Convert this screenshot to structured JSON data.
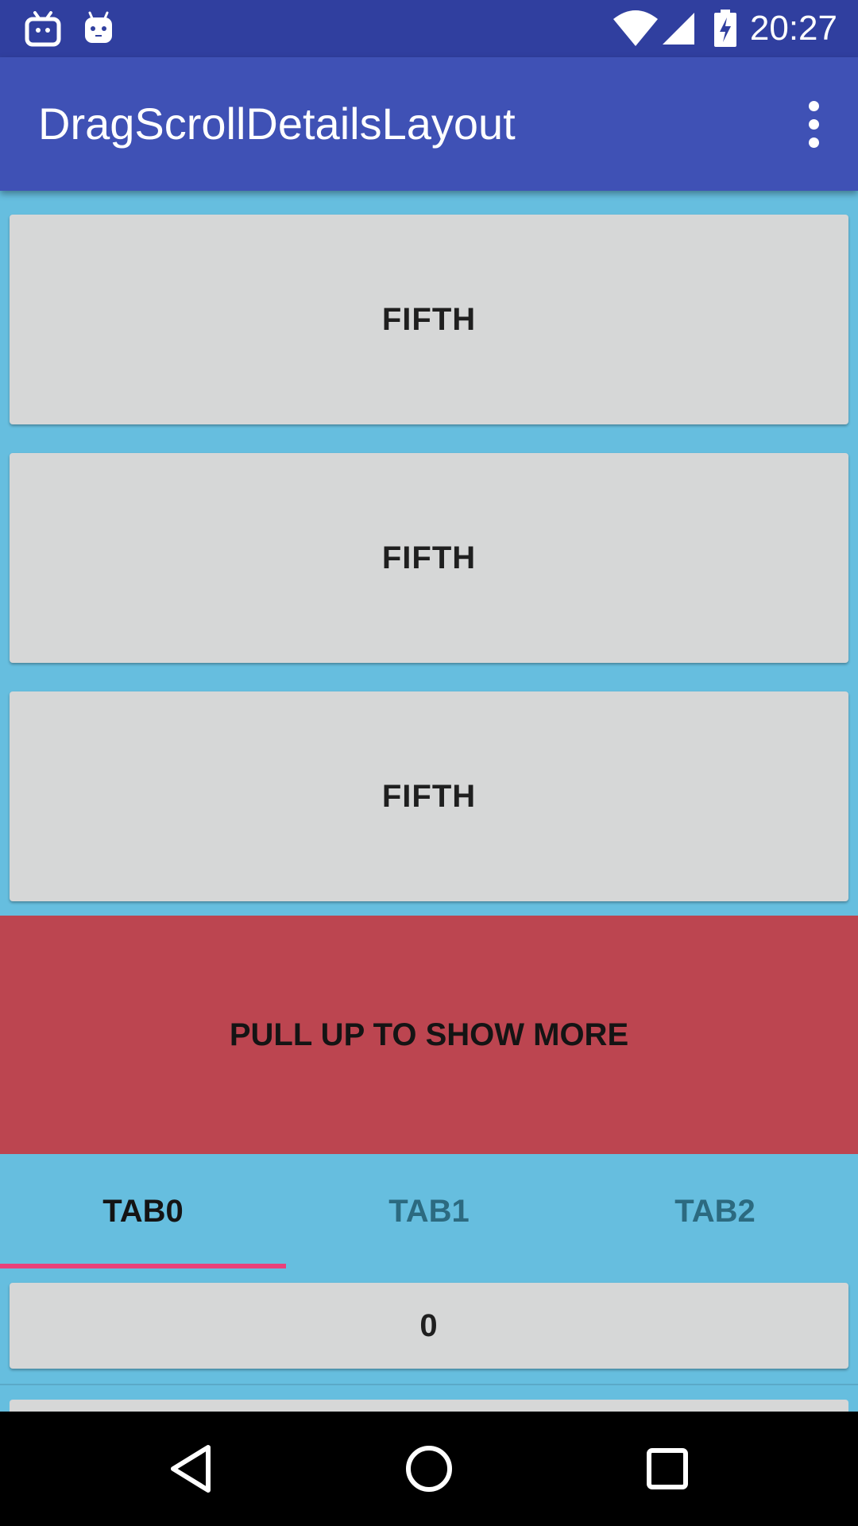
{
  "status_bar": {
    "time": "20:27",
    "left_icons": [
      "tv-app-notification-icon",
      "android-notification-icon"
    ],
    "right_icons": [
      "wifi-icon",
      "cell-signal-icon",
      "battery-charging-icon"
    ]
  },
  "app_bar": {
    "title": "DragScrollDetailsLayout",
    "menu_icon": "more-vert-icon"
  },
  "cards": [
    {
      "label": "FIFTH"
    },
    {
      "label": "FIFTH"
    },
    {
      "label": "FIFTH"
    }
  ],
  "pull_banner": {
    "label": "PULL UP TO SHOW MORE"
  },
  "tabs": [
    {
      "label": "TAB0",
      "selected": true
    },
    {
      "label": "TAB1",
      "selected": false
    },
    {
      "label": "TAB2",
      "selected": false
    }
  ],
  "list": {
    "items": [
      {
        "label": "0"
      }
    ]
  },
  "nav_bar": {
    "buttons": [
      "back-icon",
      "home-icon",
      "recents-icon"
    ]
  },
  "colors": {
    "status_bar": "#303F9F",
    "app_bar": "#3F51B5",
    "background": "#66BEDF",
    "card": "#D6D7D7",
    "banner": "#BC4550",
    "tab_indicator": "#E9407A",
    "nav_bar": "#000000"
  }
}
